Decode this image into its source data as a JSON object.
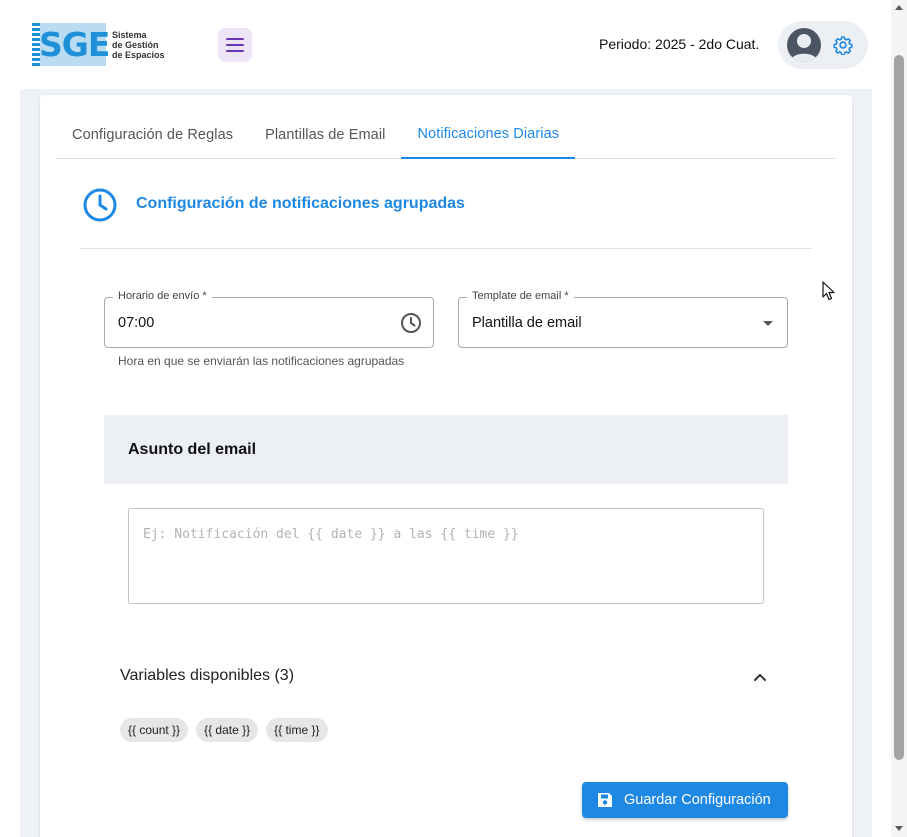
{
  "header": {
    "logo_letters": "SGE",
    "logo_text": [
      "Sistema",
      "de Gestión",
      "de Espacios"
    ],
    "period": "Periodo: 2025 - 2do Cuat."
  },
  "tabs": [
    {
      "label": "Configuración de Reglas",
      "active": false
    },
    {
      "label": "Plantillas de Email",
      "active": false
    },
    {
      "label": "Notificaciones Diarias",
      "active": true
    }
  ],
  "section": {
    "title": "Configuración de notificaciones agrupadas",
    "icon": "clock-icon"
  },
  "form": {
    "time_label": "Horario de envío *",
    "time_value": "07:00",
    "time_hint": "Hora en que se enviarán las notificaciones agrupadas",
    "template_label": "Template de email *",
    "template_value": "Plantilla de email"
  },
  "subject": {
    "title": "Asunto del email",
    "placeholder": "Ej: Notificación del {{ date }} a las {{ time }}",
    "value": ""
  },
  "variables": {
    "heading": "Variables disponibles (3)",
    "expanded": true,
    "chips": [
      "{{ count }}",
      "{{ date }}",
      "{{ time }}"
    ]
  },
  "actions": {
    "save_label": "Guardar Configuración"
  },
  "colors": {
    "accent": "#1e88e5",
    "menu_bg": "#ede4f7",
    "panel_bg": "#eceff3"
  }
}
